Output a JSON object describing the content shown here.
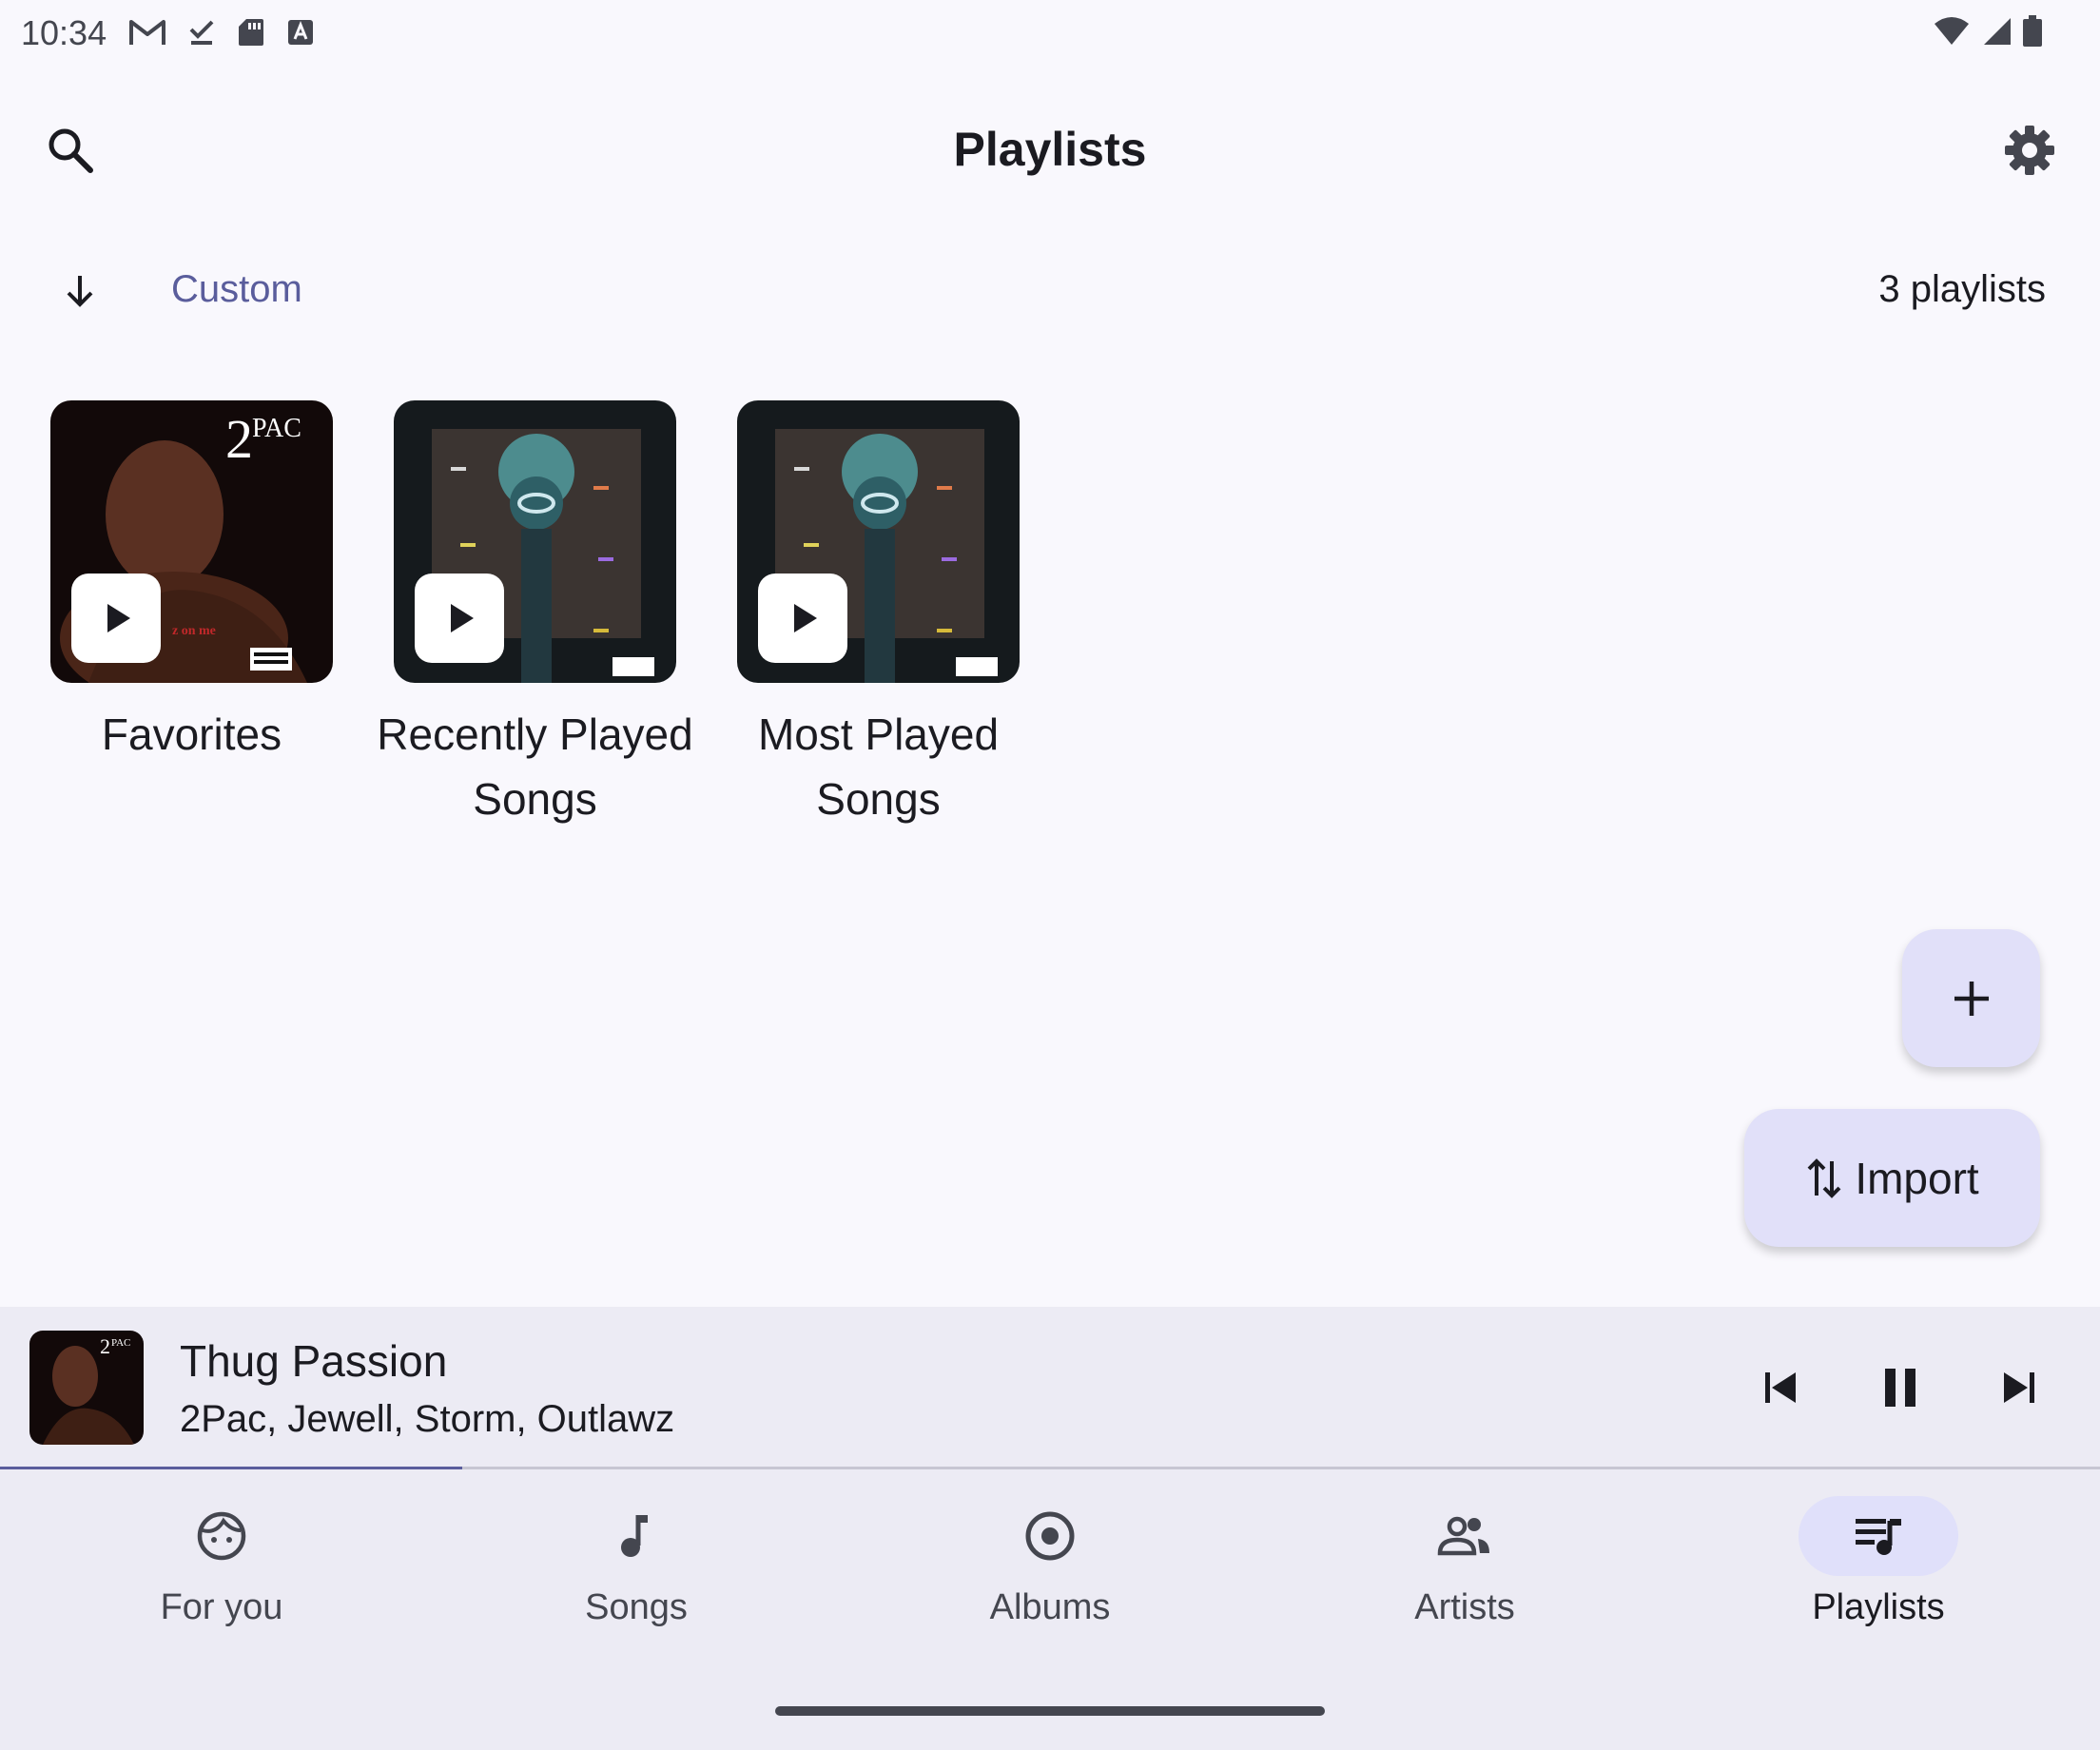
{
  "status_bar": {
    "time": "10:34",
    "left_icons": [
      "gmail-icon",
      "download-done-icon",
      "sd-card-icon",
      "keyboard-a-icon"
    ],
    "right_icons": [
      "wifi-icon",
      "cellular-signal-icon",
      "battery-icon"
    ]
  },
  "top_bar": {
    "title": "Playlists",
    "search_icon": "search-icon",
    "settings_icon": "gear-icon"
  },
  "sort": {
    "direction_icon": "arrow-down-icon",
    "label": "Custom",
    "count_label": "3 playlists"
  },
  "playlists": [
    {
      "title": "Favorites",
      "cover": "2pac-album-art"
    },
    {
      "title": "Recently Played Songs",
      "cover": "airport-album-art"
    },
    {
      "title": "Most Played Songs",
      "cover": "airport-album-art"
    }
  ],
  "fab": {
    "add_icon": "plus-icon",
    "import_label": "Import",
    "import_icon": "swap-vertical-icon"
  },
  "now_playing": {
    "title": "Thug Passion",
    "artist": "2Pac, Jewell, Storm, Outlawz",
    "progress": 0.22,
    "controls": [
      "skip-previous-icon",
      "pause-icon",
      "skip-next-icon"
    ]
  },
  "bottom_nav": {
    "active": "Playlists",
    "items": [
      {
        "label": "For you",
        "icon": "face-icon"
      },
      {
        "label": "Songs",
        "icon": "music-note-icon"
      },
      {
        "label": "Albums",
        "icon": "album-disc-icon"
      },
      {
        "label": "Artists",
        "icon": "people-icon"
      },
      {
        "label": "Playlists",
        "icon": "queue-music-icon"
      }
    ]
  },
  "colors": {
    "background": "#f9f8fd",
    "accent": "#5a5d9c",
    "fab": "#e1e0f9",
    "surface": "#ecebf4"
  }
}
